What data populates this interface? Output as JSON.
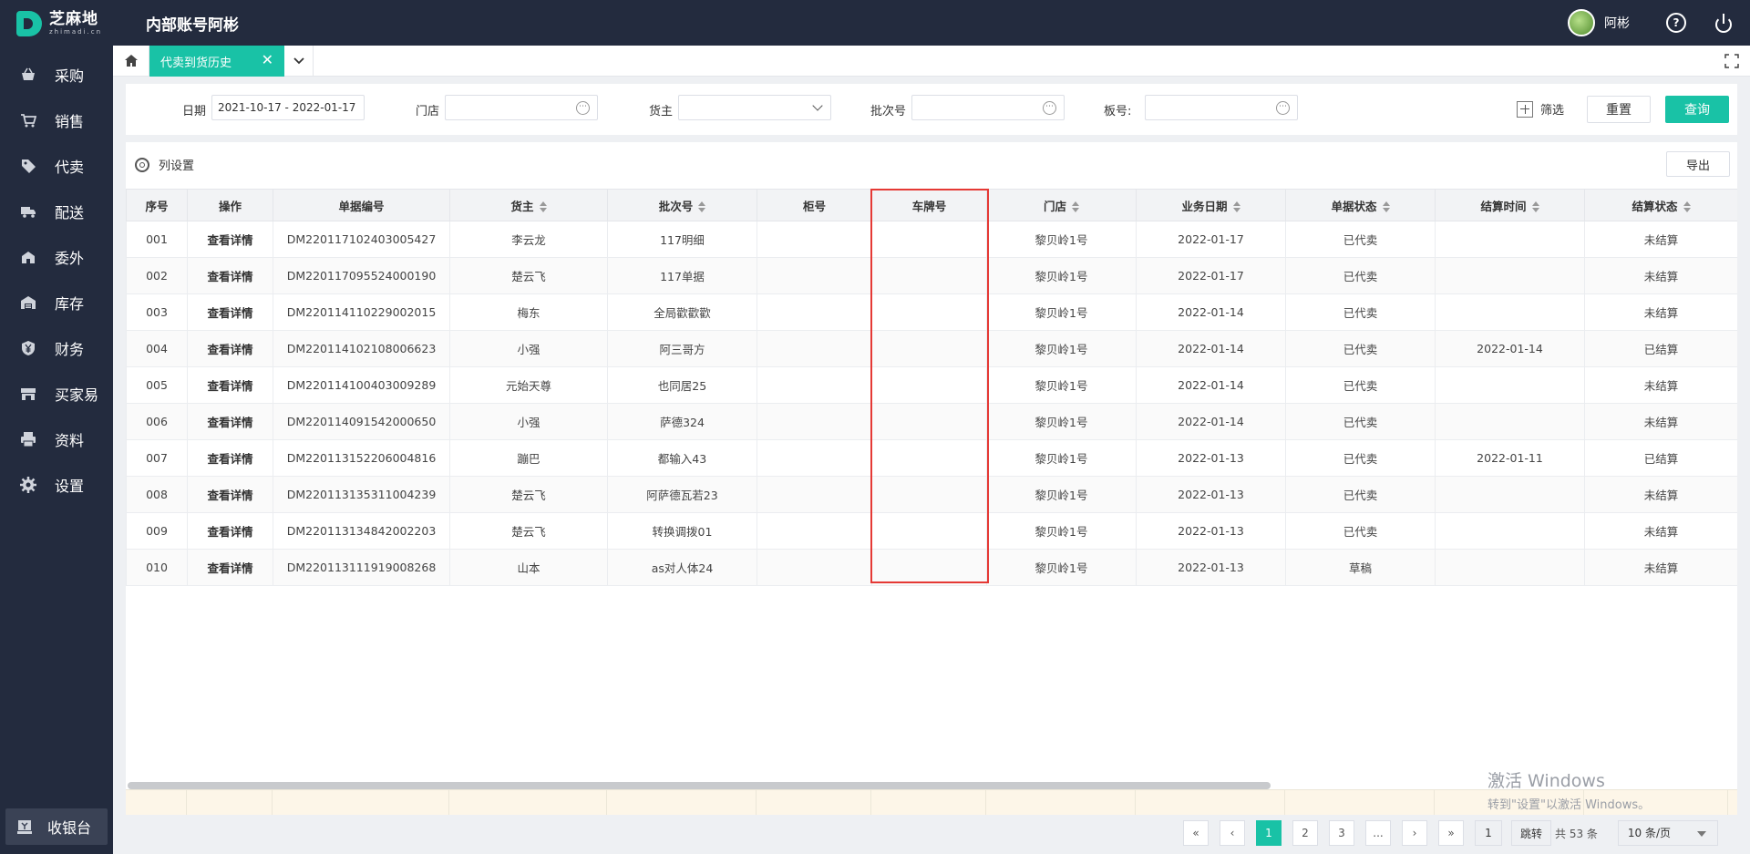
{
  "header": {
    "logo_text": "芝麻地",
    "logo_sub": "zhimadi.cn",
    "app_title": "内部账号阿彬",
    "username": "阿彬",
    "help_glyph": "?"
  },
  "sidebar": {
    "items": [
      {
        "label": "采购",
        "icon": "basket-icon"
      },
      {
        "label": "销售",
        "icon": "cart-icon"
      },
      {
        "label": "代卖",
        "icon": "tag-icon"
      },
      {
        "label": "配送",
        "icon": "truck-icon"
      },
      {
        "label": "委外",
        "icon": "building-icon"
      },
      {
        "label": "库存",
        "icon": "warehouse-icon"
      },
      {
        "label": "财务",
        "icon": "yen-shield-icon"
      },
      {
        "label": "买家易",
        "icon": "shop-icon"
      },
      {
        "label": "资料",
        "icon": "printer-icon"
      },
      {
        "label": "设置",
        "icon": "gear-icon"
      }
    ],
    "cashier": "收银台"
  },
  "tabs": {
    "active": "代卖到货历史",
    "close": "✕"
  },
  "filters": {
    "date_label": "日期",
    "date_value": "2021-10-17 - 2022-01-17",
    "store_label": "门店",
    "owner_label": "货主",
    "batch_label": "批次号",
    "board_label": "板号:",
    "filter_toggle": "筛选",
    "reset": "重置",
    "query": "查询",
    "dots": "⋯"
  },
  "toolbar": {
    "column_settings": "列设置",
    "export": "导出"
  },
  "table": {
    "columns": [
      "序号",
      "操作",
      "单据编号",
      "货主",
      "批次号",
      "柜号",
      "车牌号",
      "门店",
      "业务日期",
      "单据状态",
      "结算时间",
      "结算状态"
    ],
    "action_label": "查看详情",
    "rows": [
      [
        "001",
        "DM220117102403005427",
        "李云龙",
        "117明细",
        "",
        "",
        "黎贝岭1号",
        "2022-01-17",
        "已代卖",
        "",
        "未结算"
      ],
      [
        "002",
        "DM220117095524000190",
        "楚云飞",
        "117单据",
        "",
        "",
        "黎贝岭1号",
        "2022-01-17",
        "已代卖",
        "",
        "未结算"
      ],
      [
        "003",
        "DM220114110229002015",
        "梅东",
        "全局歡歡歡",
        "",
        "",
        "黎贝岭1号",
        "2022-01-14",
        "已代卖",
        "",
        "未结算"
      ],
      [
        "004",
        "DM220114102108006623",
        "小强",
        "阿三哥方",
        "",
        "",
        "黎贝岭1号",
        "2022-01-14",
        "已代卖",
        "2022-01-14",
        "已结算"
      ],
      [
        "005",
        "DM220114100403009289",
        "元始天尊",
        "也同居25",
        "",
        "",
        "黎贝岭1号",
        "2022-01-14",
        "已代卖",
        "",
        "未结算"
      ],
      [
        "006",
        "DM220114091542000650",
        "小强",
        "萨德324",
        "",
        "",
        "黎贝岭1号",
        "2022-01-14",
        "已代卖",
        "",
        "未结算"
      ],
      [
        "007",
        "DM220113152206004816",
        "蹦巴",
        "都输入43",
        "",
        "",
        "黎贝岭1号",
        "2022-01-13",
        "已代卖",
        "2022-01-11",
        "已结算"
      ],
      [
        "008",
        "DM220113135311004239",
        "楚云飞",
        "阿萨德瓦若23",
        "",
        "",
        "黎贝岭1号",
        "2022-01-13",
        "已代卖",
        "",
        "未结算"
      ],
      [
        "009",
        "DM220113134842002203",
        "楚云飞",
        "转换调拨01",
        "",
        "",
        "黎贝岭1号",
        "2022-01-13",
        "已代卖",
        "",
        "未结算"
      ],
      [
        "010",
        "DM220113111919008268",
        "山本",
        "as对人体24",
        "",
        "",
        "黎贝岭1号",
        "2022-01-13",
        "草稿",
        "",
        "未结算"
      ]
    ]
  },
  "pagination": {
    "first": "«",
    "prev": "‹",
    "pages": [
      "1",
      "2",
      "3",
      "..."
    ],
    "next": "›",
    "last": "»",
    "current": "1",
    "jump": "跳转",
    "total": "共 53 条",
    "page_size": "10 条/页"
  },
  "watermark": {
    "line1": "激活 Windows",
    "line2": "转到\"设置\"以激活 Windows。"
  },
  "colors": {
    "accent": "#19c2a6",
    "nav_bg": "#232b3e",
    "highlight_box": "#e53935"
  }
}
